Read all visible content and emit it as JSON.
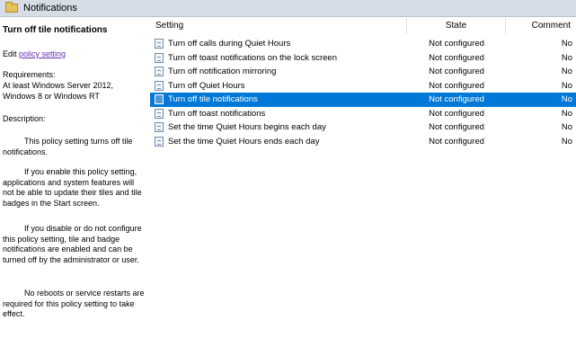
{
  "header": {
    "title": "Notifications",
    "icon": "folder-icon"
  },
  "details": {
    "heading": "Turn off tile notifications",
    "edit_prefix": "Edit ",
    "edit_link": "policy setting",
    "requirements_label": "Requirements:",
    "requirements_value": "At least Windows Server 2012, Windows 8 or Windows RT",
    "description_label": "Description:",
    "paragraphs": [
      "This policy setting turns off tile notifications.",
      "If you enable this policy setting, applications and system features will not be able to update their tiles and tile badges in the Start screen.",
      "If you disable or do not configure this policy setting, tile and badge notifications are enabled and can be turned off by the administrator or user.",
      "No reboots or service restarts are required for this policy setting to take effect."
    ]
  },
  "table": {
    "columns": {
      "setting": "Setting",
      "state": "State",
      "comment": "Comment"
    },
    "rows": [
      {
        "name": "Turn off calls during Quiet Hours",
        "state": "Not configured",
        "comment": "No",
        "selected": false
      },
      {
        "name": "Turn off toast notifications on the lock screen",
        "state": "Not configured",
        "comment": "No",
        "selected": false
      },
      {
        "name": "Turn off notification mirroring",
        "state": "Not configured",
        "comment": "No",
        "selected": false
      },
      {
        "name": "Turn off Quiet Hours",
        "state": "Not configured",
        "comment": "No",
        "selected": false
      },
      {
        "name": "Turn off tile notifications",
        "state": "Not configured",
        "comment": "No",
        "selected": true
      },
      {
        "name": "Turn off toast notifications",
        "state": "Not configured",
        "comment": "No",
        "selected": false
      },
      {
        "name": "Set the time Quiet Hours begins each day",
        "state": "Not configured",
        "comment": "No",
        "selected": false
      },
      {
        "name": "Set the time Quiet Hours ends each day",
        "state": "Not configured",
        "comment": "No",
        "selected": false
      }
    ]
  },
  "colors": {
    "selection": "#0078d7",
    "header_bg": "#d6dde6",
    "link": "#6a2fb0"
  }
}
